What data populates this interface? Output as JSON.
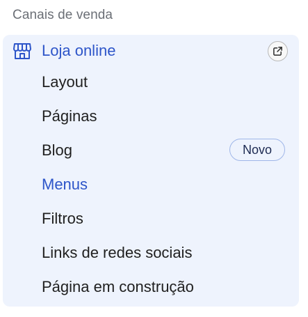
{
  "section": {
    "title": "Canais de venda"
  },
  "channel": {
    "label": "Loja online",
    "icon": "store-icon",
    "action_icon": "external-link-icon",
    "accent_color": "#2d55c9",
    "panel_color": "#eef3fd"
  },
  "nav": {
    "items": [
      {
        "label": "Layout"
      },
      {
        "label": "Páginas"
      },
      {
        "label": "Blog",
        "badge": "Novo"
      },
      {
        "label": "Menus",
        "active": true
      },
      {
        "label": "Filtros"
      },
      {
        "label": "Links de redes sociais"
      },
      {
        "label": "Página em construção"
      }
    ]
  }
}
